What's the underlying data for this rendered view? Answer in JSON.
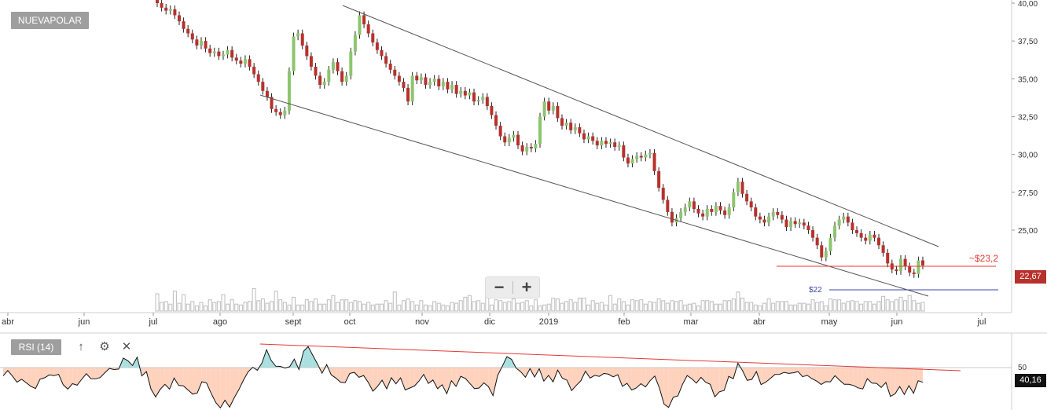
{
  "symbol": "NUEVAPOLAR",
  "zoom": {
    "out_label": "−",
    "in_label": "+"
  },
  "rsi": {
    "label": "RSI (14)",
    "level": "50",
    "current": "40,16"
  },
  "tools": {
    "up_icon": "↑",
    "gear_icon": "⚙",
    "close_icon": "✕"
  },
  "colors": {
    "up": "#8cc56e",
    "down": "#b7312c",
    "rsi_area_below": "#ffd2bd",
    "rsi_area_above": "#a9e0df",
    "trendline": "#555555",
    "resistance": "#e53935",
    "support": "#3949ab"
  },
  "chart_data": [
    {
      "type": "candlestick",
      "title": "NUEVAPOLAR",
      "x_ticks": [
        "abr",
        "jun",
        "jul",
        "ago",
        "sept",
        "oct",
        "nov",
        "dic",
        "2019",
        "feb",
        "mar",
        "abr",
        "may",
        "jun",
        "jul"
      ],
      "y_ticks": [
        "40,00",
        "37,50",
        "35,00",
        "32,50",
        "30,00",
        "27,50",
        "25,00"
      ],
      "ylim": [
        21.5,
        40.2
      ],
      "grid": false,
      "last_price": "22,67",
      "annotations": [
        {
          "text": "~$23,2",
          "value": 23.2
        },
        {
          "text": "$22",
          "value": 22.0
        }
      ],
      "series": [
        {
          "values": [
            40.0,
            39.7,
            39.5,
            39.6,
            39.2,
            38.8,
            38.3,
            38.0,
            37.6,
            37.2,
            37.5,
            37.0,
            36.7,
            36.8,
            36.5,
            36.6,
            36.9,
            36.4,
            36.2,
            36.0,
            36.3,
            35.8,
            35.3,
            34.8,
            34.2,
            33.8,
            33.0,
            32.8,
            32.6,
            32.9,
            35.5,
            37.8,
            38.0,
            37.2,
            36.5,
            35.8,
            35.2,
            34.6,
            34.8,
            35.6,
            36.1,
            35.5,
            34.8,
            35.2,
            36.8,
            37.9,
            39.2,
            38.6,
            38.0,
            37.4,
            36.9,
            36.5,
            36.0,
            35.6,
            35.2,
            34.8,
            34.4,
            33.5,
            35.2,
            34.9,
            35.1,
            34.6,
            34.8,
            35.0,
            34.5,
            34.8,
            34.3,
            34.6,
            34.0,
            34.2,
            33.9,
            34.1,
            33.5,
            33.6,
            33.8,
            33.2,
            32.6,
            31.9,
            31.2,
            30.8,
            31.1,
            31.3,
            30.6,
            30.2,
            30.5,
            30.4,
            30.7,
            32.5,
            33.5,
            32.9,
            33.2,
            32.4,
            31.9,
            32.1,
            31.6,
            31.8,
            31.4,
            31.0,
            31.2,
            30.9,
            30.6,
            30.9,
            30.7,
            30.8,
            30.5,
            30.6,
            29.8,
            29.4,
            29.7,
            29.9,
            29.8,
            30.0,
            30.1,
            28.9,
            27.8,
            27.0,
            26.2,
            25.5,
            25.8,
            26.2,
            26.5,
            26.9,
            26.4,
            26.1,
            25.9,
            26.4,
            26.2,
            26.6,
            26.3,
            26.0,
            26.5,
            27.5,
            28.2,
            27.4,
            26.9,
            26.5,
            25.9,
            25.7,
            25.5,
            25.9,
            26.2,
            26.0,
            25.7,
            25.2,
            25.6,
            25.4,
            25.5,
            25.3,
            25.0,
            24.5,
            24.0,
            23.2,
            23.6,
            24.5,
            25.3,
            25.7,
            25.9,
            25.5,
            25.0,
            24.8,
            24.5,
            24.3,
            24.7,
            24.5,
            24.0,
            23.5,
            22.8,
            22.4,
            22.3,
            23.1,
            22.6,
            22.2,
            22.1,
            23.0,
            22.67
          ]
        }
      ],
      "volume": [
        2.0,
        1.0,
        1.1,
        0.8,
        2.3,
        0.9,
        1.9,
        0.8,
        1.1,
        0.6,
        1.0,
        0.6,
        1.3,
        1.0,
        1.1,
        1.9,
        0.8,
        1.3,
        0.8,
        0.7,
        1.0,
        1.1,
        2.6,
        1.2,
        1.4,
        0.9,
        1.1,
        2.3,
        1.3,
        1.0,
        0.7,
        1.6,
        0.7,
        0.7,
        1.3,
        1.1,
        1.4,
        0.8,
        0.8,
        1.3,
        1.8,
        1.0,
        1.3,
        1.3,
        1.0,
        1.2,
        1.1,
        0.8,
        1.0,
        0.7,
        0.8,
        0.8,
        1.2,
        0.9,
        2.2,
        0.7,
        1.2,
        1.4,
        1.1,
        0.7,
        1.2,
        0.7,
        0.6,
        1.1,
        0.9,
        0.7,
        0.6,
        1.0,
        0.9,
        1.2,
        1.6,
        1.8,
        1.1,
        1.2,
        0.9,
        1.8,
        0.7,
        1.3,
        1.2,
        1.0,
        1.1,
        1.4,
        0.9,
        1.0,
        1.2,
        0.6,
        1.3,
        0.6,
        0.7,
        0.8,
        1.5,
        1.4,
        0.9,
        1.1,
        1.3,
        1.0,
        1.5,
        1.5,
        0.7,
        1.2,
        0.9,
        1.0,
        0.7,
        1.8,
        0.8,
        1.4,
        1.1,
        0.7,
        1.3,
        1.2,
        1.3,
        0.8,
        1.1,
        1.0,
        1.4,
        1.2,
        0.9,
        1.2,
        1.1,
        1.2,
        0.7,
        0.8,
        0.9,
        0.6,
        1.2,
        1.2,
        1.1,
        0.8,
        0.8,
        1.2,
        1.2,
        1.4,
        2.2,
        1.5,
        1.0,
        1.0,
        0.7,
        0.6,
        0.9,
        1.4,
        0.9,
        1.1,
        1.1,
        1.1,
        0.7,
        0.7,
        0.9,
        0.9,
        0.8,
        1.3,
        1.0,
        1.1,
        0.6,
        1.4,
        1.3,
        1.3,
        0.9,
        1.1,
        1.2,
        1.1,
        0.8,
        1.1,
        1.1,
        0.8,
        1.1,
        1.7,
        1.3,
        1.1,
        1.3,
        1.6,
        1.2,
        1.8,
        1.2,
        0.9,
        1.0
      ]
    },
    {
      "type": "line",
      "title": "RSI (14)",
      "y_ticks": [
        "50"
      ],
      "ylim": [
        20,
        80
      ],
      "last_value": "40,16",
      "series": [
        {
          "values": [
            44.4,
            48.0,
            44.3,
            40.2,
            42.2,
            39.8,
            37.4,
            36.0,
            42.2,
            43.2,
            45.1,
            44.6,
            45.5,
            38.5,
            35.6,
            39.2,
            38.2,
            42.1,
            45.9,
            42.6,
            42.5,
            43.3,
            46.5,
            49.4,
            48.7,
            49.0,
            56.3,
            54.6,
            51.4,
            57.0,
            44.4,
            47.3,
            35.6,
            30.3,
            35.5,
            38.8,
            35.6,
            43.0,
            38.0,
            37.8,
            35.0,
            32.2,
            32.9,
            40.5,
            39.8,
            32.8,
            26.6,
            23.0,
            28.1,
            23.5,
            29.8,
            35.1,
            41.6,
            47.1,
            50.2,
            48.2,
            53.0,
            62.0,
            54.8,
            50.9,
            50.8,
            49.7,
            50.6,
            55.7,
            48.7,
            60.9,
            64.1,
            58.2,
            52.6,
            46.2,
            52.0,
            45.1,
            43.0,
            40.2,
            39.9,
            46.1,
            46.8,
            43.5,
            44.7,
            40.1,
            34.2,
            37.3,
            41.5,
            35.8,
            43.2,
            39.1,
            43.1,
            35.0,
            36.3,
            37.7,
            41.0,
            45.4,
            39.4,
            41.7,
            35.9,
            38.5,
            32.5,
            41.2,
            37.4,
            44.1,
            42.8,
            39.3,
            35.9,
            36.3,
            39.8,
            37.3,
            31.2,
            44.7,
            50.9,
            57.3,
            55.6,
            49.7,
            47.2,
            43.6,
            49.3,
            43.7,
            49.2,
            40.9,
            44.8,
            40.4,
            48.3,
            42.9,
            41.5,
            34.6,
            38.0,
            41.1,
            47.6,
            43.0,
            44.8,
            44.1,
            46.1,
            45.6,
            43.8,
            45.2,
            37.4,
            39.4,
            35.0,
            36.3,
            39.2,
            37.0,
            41.2,
            44.3,
            36.3,
            25.5,
            23.3,
            30.1,
            31.0,
            38.8,
            44.7,
            42.6,
            39.6,
            43.5,
            40.2,
            38.8,
            30.4,
            33.8,
            34.7,
            44.1,
            42.6,
            53.0,
            47.9,
            41.4,
            42.1,
            47.3,
            38.6,
            40.2,
            42.7,
            45.4,
            45.5,
            46.8,
            46.1,
            46.5,
            47.3,
            43.9,
            44.8,
            42.6,
            41.0,
            38.7,
            40.6,
            40.5,
            44.6,
            41.5,
            38.8,
            38.8,
            38.0,
            36.4,
            35.7,
            42.6,
            39.6,
            39.4,
            36.7,
            40.0,
            30.7,
            32.4,
            37.3,
            32.0,
            37.9,
            32.8,
            41.2,
            40.16
          ]
        }
      ]
    }
  ]
}
